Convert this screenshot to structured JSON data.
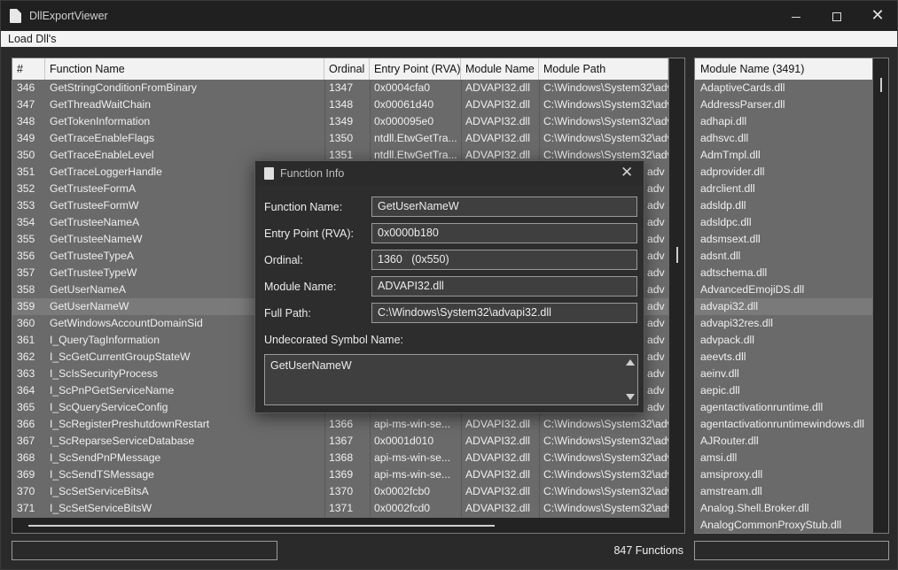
{
  "window": {
    "title": "DllExportViewer",
    "icon": "document-icon"
  },
  "menu": {
    "load_label": "Load Dll's"
  },
  "table": {
    "columns": [
      "#",
      "Function Name",
      "Ordinal",
      "Entry Point (RVA)",
      "Module Name",
      "Module Path"
    ],
    "selected_row_index": 13,
    "rows": [
      {
        "num": "346",
        "name": "GetStringConditionFromBinary",
        "ordinal": "1347",
        "entry": "0x0004cfa0",
        "module": "ADVAPI32.dll",
        "path": "C:\\Windows\\System32\\adv"
      },
      {
        "num": "347",
        "name": "GetThreadWaitChain",
        "ordinal": "1348",
        "entry": "0x00061d40",
        "module": "ADVAPI32.dll",
        "path": "C:\\Windows\\System32\\adv"
      },
      {
        "num": "348",
        "name": "GetTokenInformation",
        "ordinal": "1349",
        "entry": "0x000095e0",
        "module": "ADVAPI32.dll",
        "path": "C:\\Windows\\System32\\adv"
      },
      {
        "num": "349",
        "name": "GetTraceEnableFlags",
        "ordinal": "1350",
        "entry": "ntdll.EtwGetTra...",
        "module": "ADVAPI32.dll",
        "path": "C:\\Windows\\System32\\adv"
      },
      {
        "num": "350",
        "name": "GetTraceEnableLevel",
        "ordinal": "1351",
        "entry": "ntdll.EtwGetTra...",
        "module": "ADVAPI32.dll",
        "path": "C:\\Windows\\System32\\adv"
      },
      {
        "num": "351",
        "name": "GetTraceLoggerHandle",
        "ordinal": "",
        "entry": "",
        "module": "",
        "path": "adv"
      },
      {
        "num": "352",
        "name": "GetTrusteeFormA",
        "ordinal": "",
        "entry": "",
        "module": "",
        "path": "adv"
      },
      {
        "num": "353",
        "name": "GetTrusteeFormW",
        "ordinal": "",
        "entry": "",
        "module": "",
        "path": "adv"
      },
      {
        "num": "354",
        "name": "GetTrusteeNameA",
        "ordinal": "",
        "entry": "",
        "module": "",
        "path": "adv"
      },
      {
        "num": "355",
        "name": "GetTrusteeNameW",
        "ordinal": "",
        "entry": "",
        "module": "",
        "path": "adv"
      },
      {
        "num": "356",
        "name": "GetTrusteeTypeA",
        "ordinal": "",
        "entry": "",
        "module": "",
        "path": "adv"
      },
      {
        "num": "357",
        "name": "GetTrusteeTypeW",
        "ordinal": "",
        "entry": "",
        "module": "",
        "path": "adv"
      },
      {
        "num": "358",
        "name": "GetUserNameA",
        "ordinal": "",
        "entry": "",
        "module": "",
        "path": "adv"
      },
      {
        "num": "359",
        "name": "GetUserNameW",
        "ordinal": "",
        "entry": "",
        "module": "",
        "path": "adv"
      },
      {
        "num": "360",
        "name": "GetWindowsAccountDomainSid",
        "ordinal": "",
        "entry": "",
        "module": "",
        "path": "adv"
      },
      {
        "num": "361",
        "name": "I_QueryTagInformation",
        "ordinal": "",
        "entry": "",
        "module": "",
        "path": "adv"
      },
      {
        "num": "362",
        "name": "I_ScGetCurrentGroupStateW",
        "ordinal": "",
        "entry": "",
        "module": "",
        "path": "adv"
      },
      {
        "num": "363",
        "name": "I_ScIsSecurityProcess",
        "ordinal": "",
        "entry": "",
        "module": "",
        "path": "adv"
      },
      {
        "num": "364",
        "name": "I_ScPnPGetServiceName",
        "ordinal": "",
        "entry": "",
        "module": "",
        "path": "adv"
      },
      {
        "num": "365",
        "name": "I_ScQueryServiceConfig",
        "ordinal": "",
        "entry": "",
        "module": "",
        "path": "adv"
      },
      {
        "num": "366",
        "name": "I_ScRegisterPreshutdownRestart",
        "ordinal": "1366",
        "entry": "api-ms-win-se...",
        "module": "ADVAPI32.dll",
        "path": "C:\\Windows\\System32\\adv"
      },
      {
        "num": "367",
        "name": "I_ScReparseServiceDatabase",
        "ordinal": "1367",
        "entry": "0x0001d010",
        "module": "ADVAPI32.dll",
        "path": "C:\\Windows\\System32\\adv"
      },
      {
        "num": "368",
        "name": "I_ScSendPnPMessage",
        "ordinal": "1368",
        "entry": "api-ms-win-se...",
        "module": "ADVAPI32.dll",
        "path": "C:\\Windows\\System32\\adv"
      },
      {
        "num": "369",
        "name": "I_ScSendTSMessage",
        "ordinal": "1369",
        "entry": "api-ms-win-se...",
        "module": "ADVAPI32.dll",
        "path": "C:\\Windows\\System32\\adv"
      },
      {
        "num": "370",
        "name": "I_ScSetServiceBitsA",
        "ordinal": "1370",
        "entry": "0x0002fcb0",
        "module": "ADVAPI32.dll",
        "path": "C:\\Windows\\System32\\adv"
      },
      {
        "num": "371",
        "name": "I_ScSetServiceBitsW",
        "ordinal": "1371",
        "entry": "0x0002fcd0",
        "module": "ADVAPI32.dll",
        "path": "C:\\Windows\\System32\\adv"
      }
    ]
  },
  "modules": {
    "header": "Module Name (3491)",
    "selected_index": 13,
    "items": [
      "AdaptiveCards.dll",
      "AddressParser.dll",
      "adhapi.dll",
      "adhsvc.dll",
      "AdmTmpl.dll",
      "adprovider.dll",
      "adrclient.dll",
      "adsldp.dll",
      "adsldpc.dll",
      "adsmsext.dll",
      "adsnt.dll",
      "adtschema.dll",
      "AdvancedEmojiDS.dll",
      "advapi32.dll",
      "advapi32res.dll",
      "advpack.dll",
      "aeevts.dll",
      "aeinv.dll",
      "aepic.dll",
      "agentactivationruntime.dll",
      "agentactivationruntimewindows.dll",
      "AJRouter.dll",
      "amsi.dll",
      "amsiproxy.dll",
      "amstream.dll",
      "Analog.Shell.Broker.dll",
      "AnalogCommonProxyStub.dll"
    ]
  },
  "status": {
    "count": "847 Functions"
  },
  "dialog": {
    "title": "Function Info",
    "labels": {
      "function_name": "Function Name:",
      "entry_point": "Entry Point (RVA):",
      "ordinal": "Ordinal:",
      "module_name": "Module Name:",
      "full_path": "Full Path:",
      "undecorated": "Undecorated Symbol Name:"
    },
    "values": {
      "function_name": "GetUserNameW",
      "entry_point": "0x0000b180",
      "ordinal": "1360   (0x550)",
      "module_name": "ADVAPI32.dll",
      "full_path": "C:\\Windows\\System32\\advapi32.dll",
      "undecorated": "GetUserNameW"
    }
  }
}
